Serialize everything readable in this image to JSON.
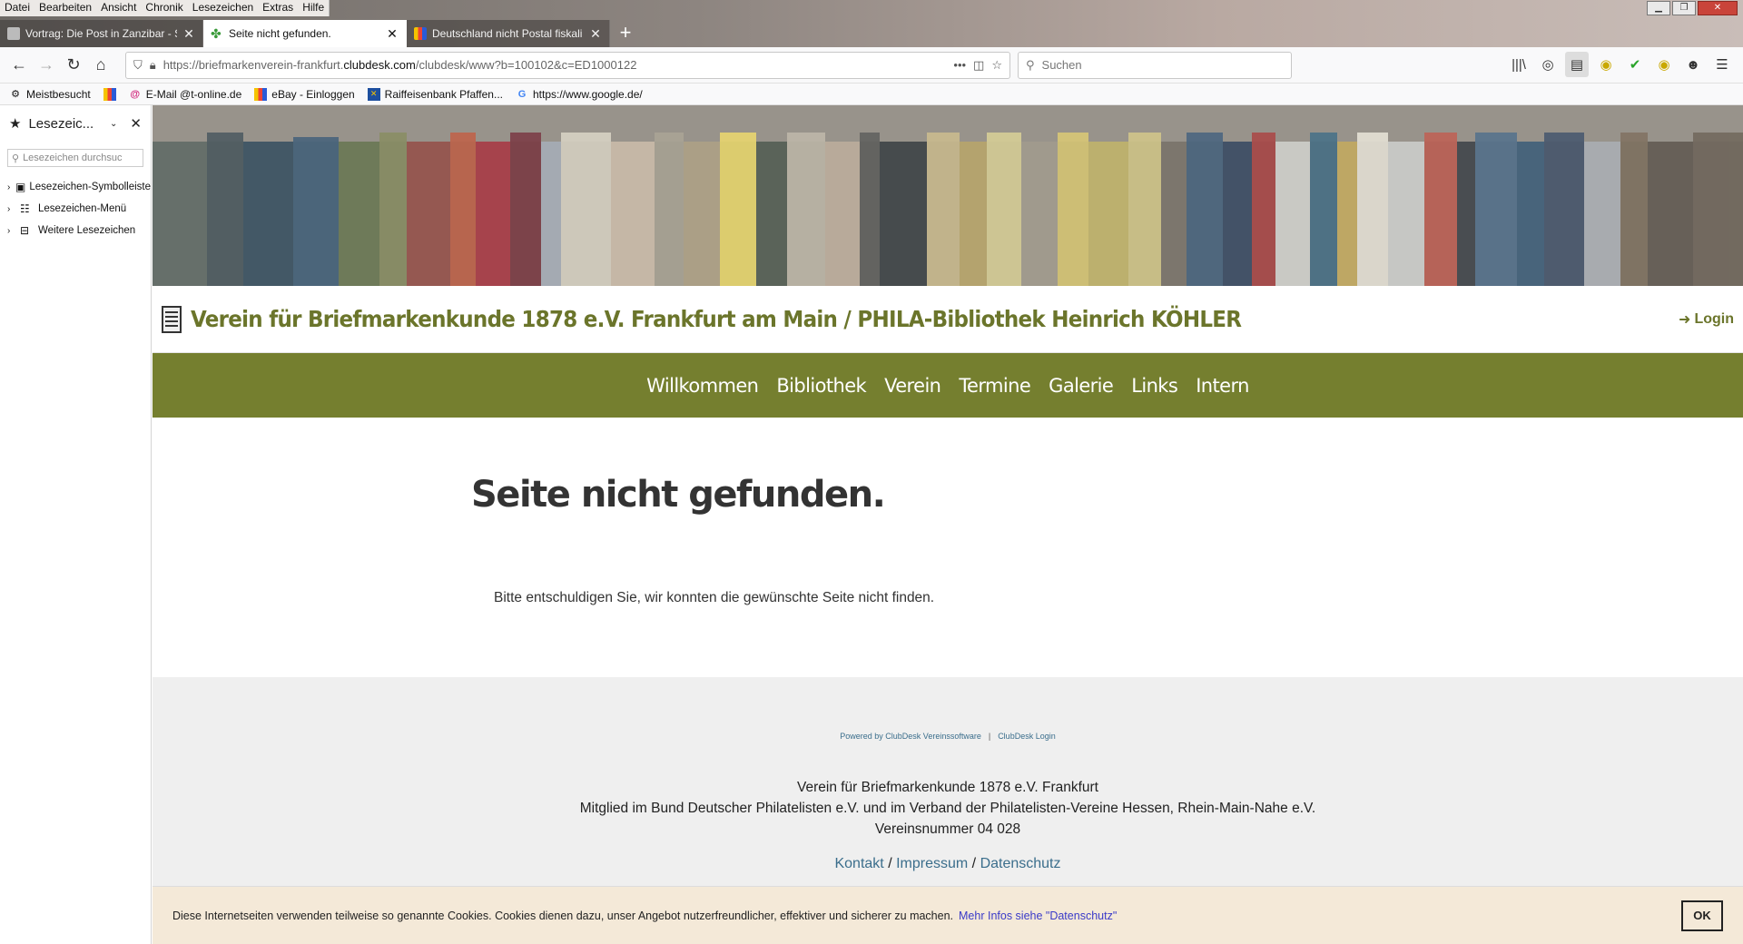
{
  "menubar": [
    "Datei",
    "Bearbeiten",
    "Ansicht",
    "Chronik",
    "Lesezeichen",
    "Extras",
    "Hilfe"
  ],
  "tabs": [
    {
      "title": "Vortrag: Die Post in Zanzibar - S",
      "active": false
    },
    {
      "title": "Seite nicht gefunden.",
      "active": true
    },
    {
      "title": "Deutschland nicht Postal fiskali",
      "active": false
    }
  ],
  "urlbar": {
    "prefix": "https://briefmarkenverein-frankfurt.",
    "domain": "clubdesk.com",
    "suffix": "/clubdesk/www?b=100102&c=ED1000122"
  },
  "search": {
    "placeholder": "Suchen"
  },
  "bookmarks": [
    "Meistbesucht",
    "E-Mail @t-online.de",
    "eBay - Einloggen",
    "Raiffeisenbank Pfaffen...",
    "https://www.google.de/"
  ],
  "sidebar": {
    "title": "Lesezeic...",
    "search_placeholder": "Lesezeichen durchsuc",
    "items": [
      "Lesezeichen-Symbolleiste",
      "Lesezeichen-Menü",
      "Weitere Lesezeichen"
    ]
  },
  "site": {
    "title": "Verein für Briefmarkenkunde 1878 e.V. Frankfurt am Main / PHILA-Bibliothek Heinrich KÖHLER",
    "login": "Login",
    "nav": [
      "Willkommen",
      "Bibliothek",
      "Verein",
      "Termine",
      "Galerie",
      "Links",
      "Intern"
    ],
    "brand_color": "#757f2f"
  },
  "article": {
    "heading": "Seite nicht gefunden.",
    "body": "Bitte entschuldigen Sie, wir konnten die gewünschte Seite nicht finden."
  },
  "footer": {
    "powered": "Powered by ClubDesk Vereinssoftware",
    "clubdesk_login": "ClubDesk Login",
    "line1": "Verein für Briefmarkenkunde 1878 e.V. Frankfurt",
    "line2": "Mitglied im Bund Deutscher Philatelisten e.V. und im Verband der Philatelisten-Vereine Hessen, Rhein-Main-Nahe e.V.",
    "line3": "Vereinsnummer 04 028",
    "links": [
      "Kontakt",
      "Impressum",
      "Datenschutz"
    ]
  },
  "cookie": {
    "text": "Diese Internetseiten verwenden teilweise so genannte Cookies. Cookies dienen dazu, unser Angebot nutzerfreundlicher, effektiver und sicherer zu machen.",
    "more": "Mehr Infos siehe \"Datenschutz\"",
    "ok": "OK"
  }
}
